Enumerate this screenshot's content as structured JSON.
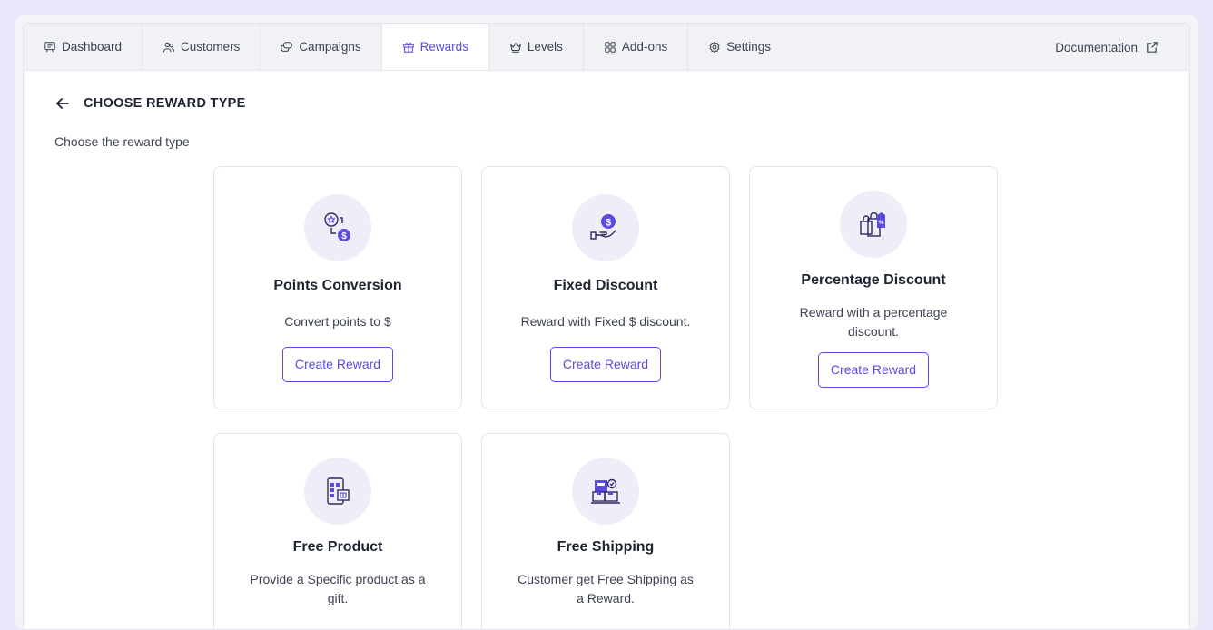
{
  "tabs": [
    {
      "label": "Dashboard",
      "icon": "presentation-icon"
    },
    {
      "label": "Customers",
      "icon": "users-icon"
    },
    {
      "label": "Campaigns",
      "icon": "chat-bubbles-icon"
    },
    {
      "label": "Rewards",
      "icon": "gift-icon"
    },
    {
      "label": "Levels",
      "icon": "crown-icon"
    },
    {
      "label": "Add-ons",
      "icon": "grid-icon"
    },
    {
      "label": "Settings",
      "icon": "gear-icon"
    }
  ],
  "active_tab": "Rewards",
  "documentation_label": "Documentation",
  "page": {
    "title": "CHOOSE REWARD TYPE",
    "subtitle": "Choose the reward type"
  },
  "cards": [
    {
      "title": "Points Conversion",
      "desc": "Convert points to $",
      "button": "Create Reward",
      "icon": "points-conversion-icon"
    },
    {
      "title": "Fixed Discount",
      "desc": "Reward with Fixed $ discount.",
      "button": "Create Reward",
      "icon": "hand-coin-icon"
    },
    {
      "title": "Percentage Discount",
      "desc_line1": "Reward with a percentage",
      "desc_line2": "discount.",
      "button": "Create Reward",
      "icon": "shopping-bags-icon"
    },
    {
      "title": "Free Product",
      "desc_line1": "Provide a Specific product as a",
      "desc_line2": "gift.",
      "icon": "phone-gift-icon"
    },
    {
      "title": "Free Shipping",
      "desc_line1": "Customer get Free Shipping as",
      "desc_line2": "a Reward.",
      "icon": "shipping-boxes-icon"
    }
  ],
  "colors": {
    "accent": "#5b4be0",
    "background": "#e9e8fb",
    "icon_bg": "#eeedf8"
  }
}
